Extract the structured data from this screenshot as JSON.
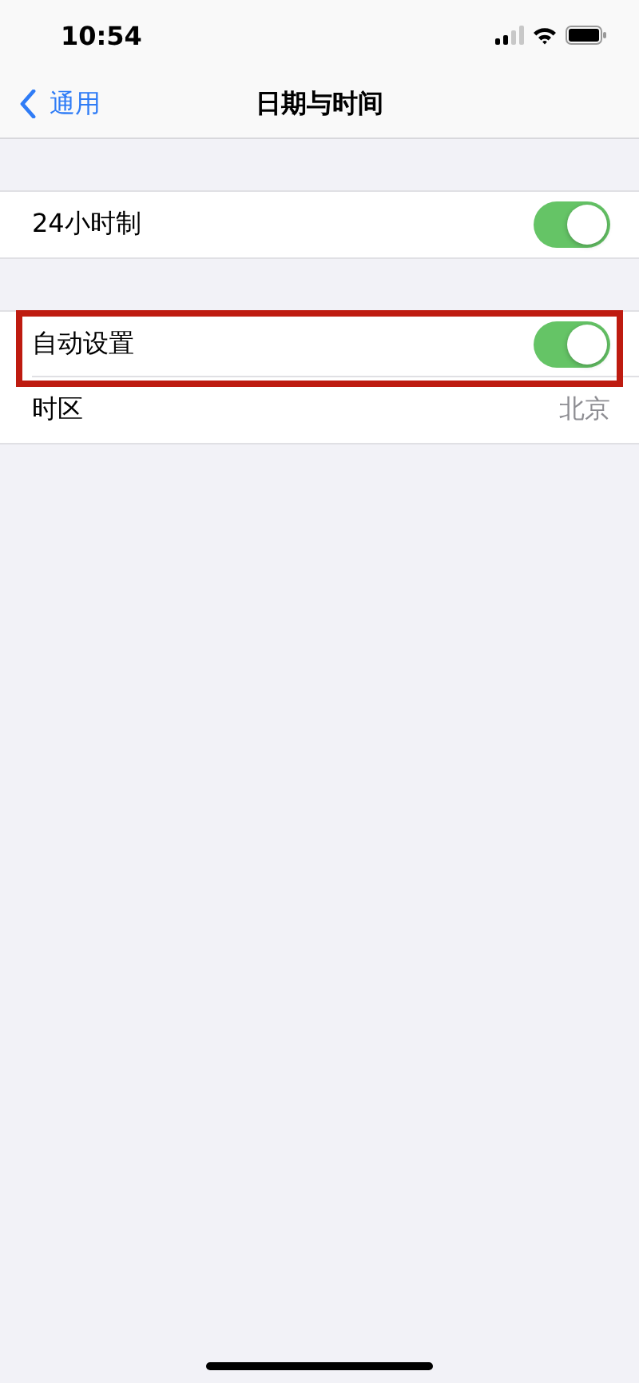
{
  "status_bar": {
    "time": "10:54"
  },
  "nav": {
    "back": "通用",
    "title": "日期与时间"
  },
  "sections": [
    {
      "rows": [
        {
          "kind": "toggle",
          "label": "24小时制",
          "on": true,
          "highlighted": false
        }
      ]
    },
    {
      "rows": [
        {
          "kind": "toggle",
          "label": "自动设置",
          "on": true,
          "highlighted": true
        },
        {
          "kind": "value",
          "label": "时区",
          "value": "北京",
          "highlighted": false
        }
      ]
    }
  ]
}
